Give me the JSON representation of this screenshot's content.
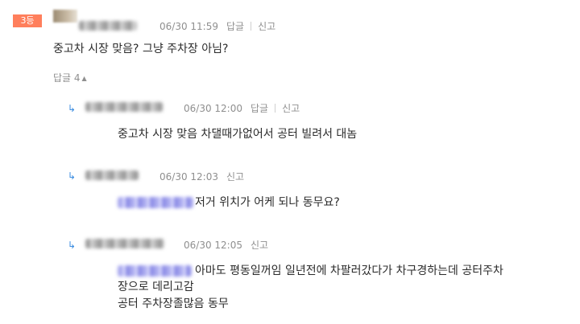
{
  "comment": {
    "rank_badge": "3등",
    "timestamp": "06/30 11:59",
    "reply_label": "답글",
    "report_label": "신고",
    "text": "중고차 시장 맞음? 그냥 주차장 아님?",
    "replies_toggle": "답글 4",
    "replies_toggle_icon": "caret-up-icon"
  },
  "replies": [
    {
      "arrow_icon": "reply-arrow-icon",
      "timestamp": "06/30 12:00",
      "reply_label": "답글",
      "report_label": "신고",
      "text": "중고차 시장 맞음 차댈때가없어서 공터 빌려서 대놈"
    },
    {
      "arrow_icon": "reply-arrow-icon",
      "timestamp": "06/30 12:03",
      "report_label": "신고",
      "text": "저거 위치가 어케 되나 동무요?"
    },
    {
      "arrow_icon": "reply-arrow-icon",
      "timestamp": "06/30 12:05",
      "report_label": "신고",
      "text_line1": "아마도 평동일꺼임 일년전에 차팔러갔다가 차구경하는데 공터주차",
      "text_line2": "장으로 데리고감",
      "text_line3": "공터 주차장졸많음 동무"
    }
  ],
  "colors": {
    "badge": "#ff7f5c",
    "arrow": "#3b8de0",
    "meta_text": "#8f8f8f",
    "mention_blur": "#a8a8ee"
  }
}
